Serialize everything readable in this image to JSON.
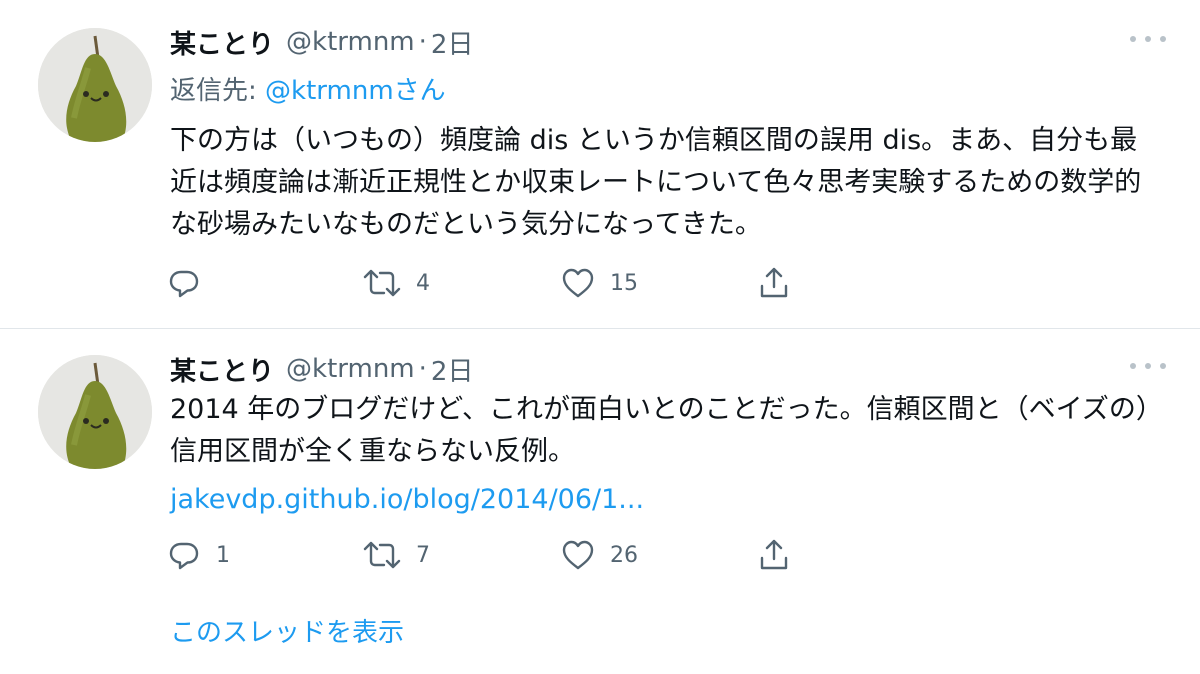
{
  "tweets": [
    {
      "author_name": "某ことり",
      "handle": "@ktrmnm",
      "separator": "·",
      "time": "2日",
      "reply_to": {
        "prefix": "返信先: ",
        "mention": "@ktrmnm",
        "suffix": "さん"
      },
      "text": "下の方は（いつもの）頻度論 dis というか信頼区間の誤用 dis。まあ、自分も最近は頻度論は漸近正規性とか収束レートについて色々思考実験するための数学的な砂場みたいなものだという気分になってきた。",
      "actions": {
        "reply_count": "",
        "retweet_count": "4",
        "like_count": "15"
      }
    },
    {
      "author_name": "某ことり",
      "handle": "@ktrmnm",
      "separator": "·",
      "time": "2日",
      "text": "2014 年のブログだけど、これが面白いとのことだった。信頼区間と（ベイズの）信用区間が全く重ならない反例。",
      "link": "jakevdp.github.io/blog/2014/06/1...",
      "actions": {
        "reply_count": "1",
        "retweet_count": "7",
        "like_count": "26"
      }
    }
  ],
  "show_thread_label": "このスレッドを表示",
  "icons": [
    "more-icon",
    "reply-icon",
    "retweet-icon",
    "like-icon",
    "share-icon",
    "avatar-pear"
  ],
  "colors": {
    "link": "#1d9bf0",
    "secondary_text": "#536471",
    "primary_text": "#0f1419",
    "divider": "#e1e6ea"
  }
}
